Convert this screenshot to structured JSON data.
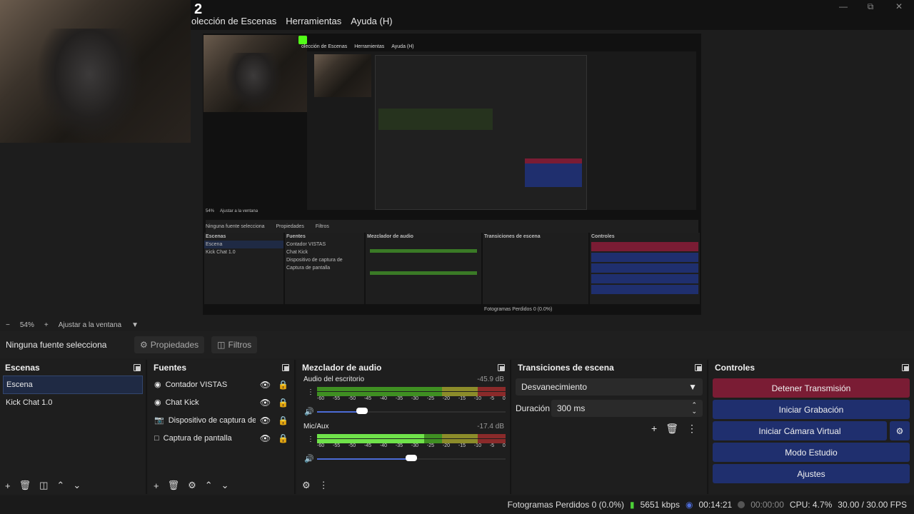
{
  "window": {
    "logo_number": "2",
    "menu": [
      "olección de Escenas",
      "Herramientas",
      "Ayuda (H)"
    ]
  },
  "nested": {
    "menu": [
      "olección de Escenas",
      "Herramientas",
      "Ayuda (H)"
    ],
    "zoom": "54%",
    "fit": "Ajustar a la ventana",
    "no_source": "Ninguna fuente selecciona",
    "props": "Propiedades",
    "filters": "Filtros",
    "scenes_title": "Escenas",
    "scene1": "Escena",
    "scene2": "Kick Chat 1.0",
    "sources_title": "Fuentes",
    "src1": "Contador VISTAS",
    "src2": "Chat Kick",
    "src3": "Dispositivo de captura de",
    "src4": "Captura de pantalla",
    "mixer_title": "Mezclador de audio",
    "trans_title": "Transiciones de escena",
    "ctrl_title": "Controles",
    "status": "Fotogramas Perdidos 0 (0.0%)"
  },
  "zoom": {
    "minus": "−",
    "value": "54%",
    "plus": "+",
    "fit": "Ajustar a la ventana"
  },
  "props_bar": {
    "no_source": "Ninguna fuente selecciona",
    "properties": "Propiedades",
    "filters": "Filtros"
  },
  "scenes": {
    "title": "Escenas",
    "items": [
      "Escena",
      "Kick Chat 1.0"
    ]
  },
  "sources": {
    "title": "Fuentes",
    "items": [
      "Contador VISTAS",
      "Chat Kick",
      "Dispositivo de captura de",
      "Captura de pantalla"
    ]
  },
  "mixer": {
    "title": "Mezclador de audio",
    "channels": [
      {
        "name": "Audio del escritorio",
        "db": "-45.9 dB",
        "volume": 0.24
      },
      {
        "name": "Mic/Aux",
        "db": "-17.4 dB",
        "volume": 0.5
      }
    ],
    "ticks": [
      "-60",
      "-55",
      "-50",
      "-45",
      "-40",
      "-35",
      "-30",
      "-25",
      "-20",
      "-15",
      "-10",
      "-5",
      "0"
    ]
  },
  "transitions": {
    "title": "Transiciones de escena",
    "type": "Desvanecimiento",
    "duration_label": "Duración",
    "duration": "300 ms"
  },
  "controls": {
    "title": "Controles",
    "stop_stream": "Detener Transmisión",
    "start_record": "Iniciar Grabación",
    "virtual_cam": "Iniciar Cámara Virtual",
    "studio_mode": "Modo Estudio",
    "settings": "Ajustes",
    "colors": {
      "stop": "#7a1c34",
      "normal": "#1f2f6e"
    }
  },
  "status": {
    "dropped": "Fotogramas Perdidos 0 (0.0%)",
    "bitrate": "5651 kbps",
    "live_time": "00:14:21",
    "rec_time": "00:00:00",
    "cpu": "CPU: 4.7%",
    "fps": "30.00 / 30.00 FPS"
  }
}
